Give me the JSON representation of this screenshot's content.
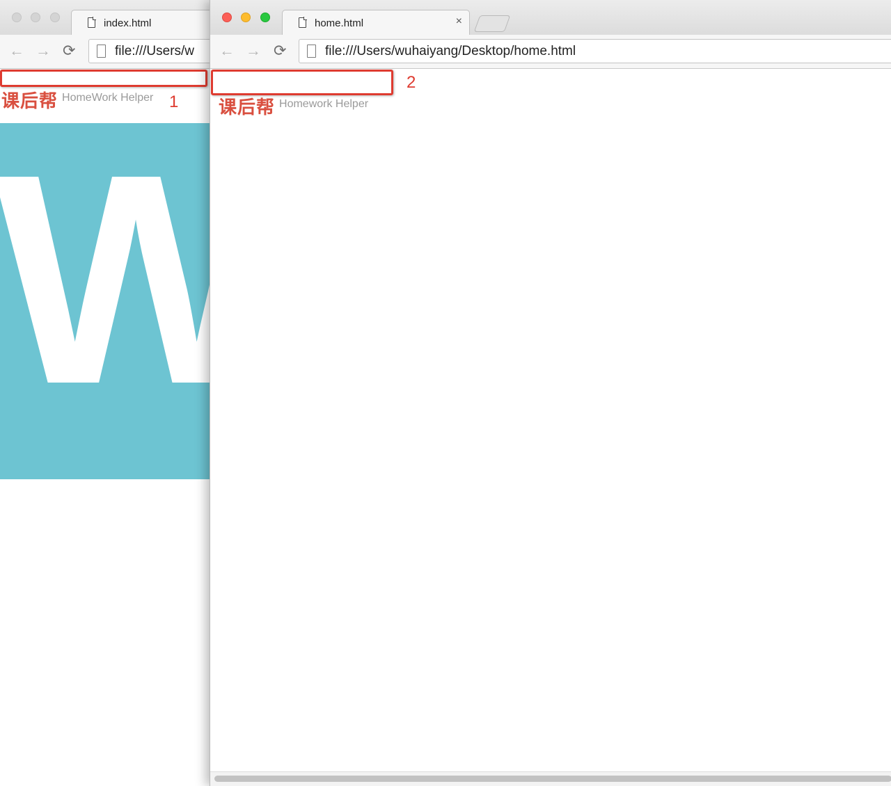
{
  "back_window": {
    "tab": {
      "title": "index.html"
    },
    "address": {
      "url": "file:///Users/w"
    },
    "page": {
      "brand_cn": "课后帮",
      "brand_en": "HomeWork Helper",
      "hero_text": "We"
    },
    "annotation": {
      "number": "1",
      "color": "#de3b30"
    }
  },
  "front_window": {
    "tab": {
      "title": "home.html",
      "close_glyph": "×"
    },
    "address": {
      "url": "file:///Users/wuhaiyang/Desktop/home.html"
    },
    "page": {
      "brand_cn": "课后帮",
      "brand_en": "Homework Helper"
    },
    "annotation": {
      "number": "2",
      "color": "#de3b30"
    }
  },
  "icons": {
    "back": "←",
    "forward": "→",
    "reload": "⟳"
  },
  "colors": {
    "hero_bg": "#6dc4d2",
    "brand_red": "#d94f3f",
    "traffic_close": "#fc5f57",
    "traffic_min": "#fdbc2e",
    "traffic_max": "#29c840"
  }
}
